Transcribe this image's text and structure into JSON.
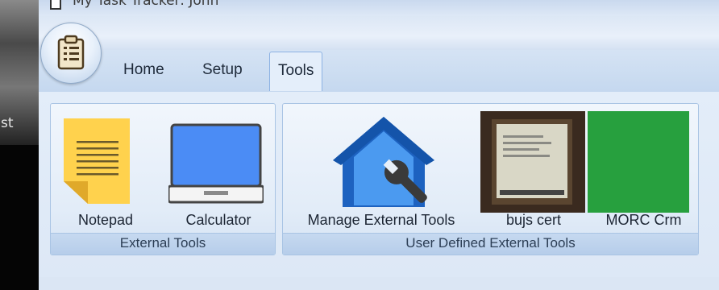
{
  "window": {
    "title": "My Task Tracker: John"
  },
  "desktop": {
    "fragment_text": "st"
  },
  "tabs": [
    {
      "label": "Home",
      "active": false
    },
    {
      "label": "Setup",
      "active": false
    },
    {
      "label": "Tools",
      "active": true
    }
  ],
  "groups": [
    {
      "label": "External Tools",
      "buttons": [
        {
          "label": "Notepad",
          "icon": "notepad-icon"
        },
        {
          "label": "Calculator",
          "icon": "calculator-icon"
        }
      ]
    },
    {
      "label": "User Defined External Tools",
      "buttons": [
        {
          "label": "Manage External Tools",
          "icon": "house-wrench-icon"
        },
        {
          "label": "bujs cert",
          "icon": "photo-thumbnail"
        },
        {
          "label": "MORC Crm",
          "icon": "green-tile-icon"
        }
      ]
    }
  ],
  "colors": {
    "accent": "#1d62c0",
    "notepad": "#ffd24d",
    "screen": "#4b8cf5",
    "green": "#27a03e"
  }
}
